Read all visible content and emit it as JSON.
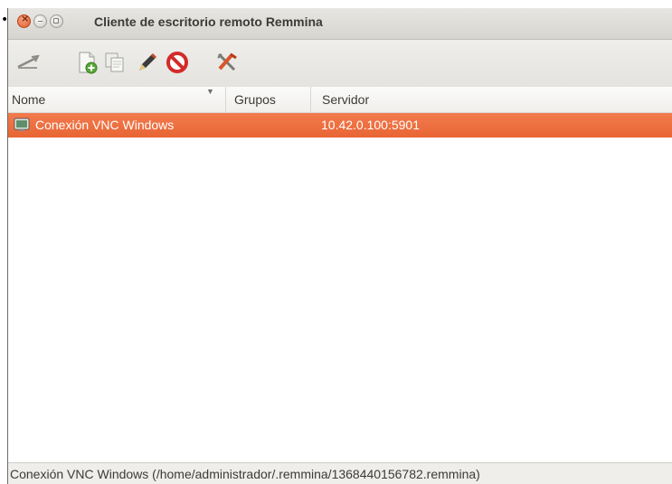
{
  "page": {
    "bullet": "•"
  },
  "window": {
    "title": "Cliente de escritorio remoto Remmina"
  },
  "toolbar": {
    "icons": [
      "connect-icon",
      "new-file-icon",
      "copy-icon",
      "edit-icon",
      "delete-icon",
      "preferences-icon"
    ]
  },
  "table": {
    "columns": [
      "Nome",
      "Grupos",
      "Servidor"
    ],
    "rows": [
      {
        "name": "Conexión VNC Windows",
        "group": "",
        "server": "10.42.0.100:5901",
        "selected": true
      }
    ]
  },
  "statusbar": {
    "text": "Conexión VNC Windows (/home/administrador/.remmina/1368440156782.remmina)"
  },
  "colors": {
    "selection": "#e86534",
    "close_button": "#e05a2a"
  }
}
